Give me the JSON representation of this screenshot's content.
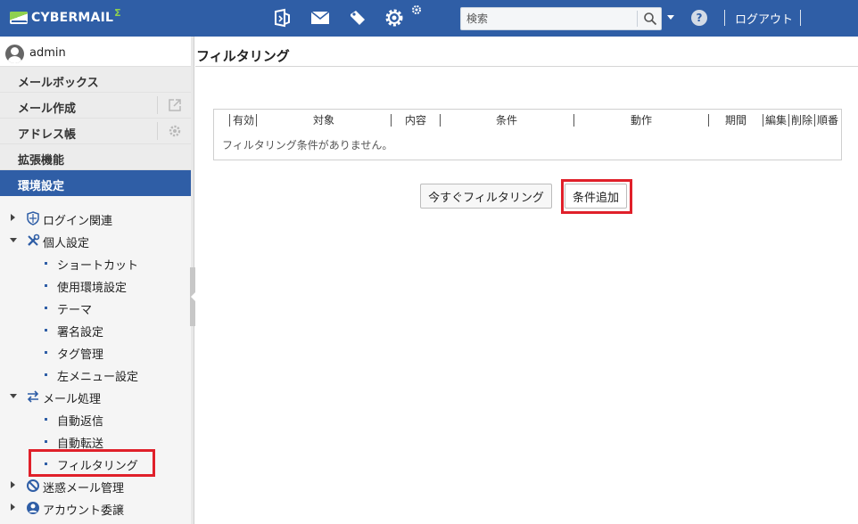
{
  "app": {
    "logo_text": "CYBERMAIL",
    "logo_mark": "Σ"
  },
  "topbar": {
    "icons": [
      "mail-open-icon",
      "envelope-icon",
      "tag-icon",
      "gear-icon",
      "small-gear-icon"
    ],
    "search_placeholder": "検索",
    "logout_label": "ログアウト",
    "help_glyph": "?"
  },
  "user": {
    "name": "admin"
  },
  "nav": {
    "items": [
      {
        "label": "メールボックス"
      },
      {
        "label": "メール作成"
      },
      {
        "label": "アドレス帳"
      },
      {
        "label": "拡張機能"
      },
      {
        "label": "環境設定"
      }
    ],
    "active_index": 4
  },
  "tree": {
    "login": "ログイン関連",
    "personal": "個人設定",
    "personal_children": [
      "ショートカット",
      "使用環境設定",
      "テーマ",
      "署名設定",
      "タグ管理",
      "左メニュー設定"
    ],
    "mail_processing": "メール処理",
    "mail_processing_children": [
      "自動返信",
      "自動転送",
      "フィルタリング"
    ],
    "spam": "迷惑メール管理",
    "account": "アカウント委譲"
  },
  "main": {
    "title": "フィルタリング",
    "columns": [
      "有効",
      "対象",
      "内容",
      "条件",
      "動作",
      "期間",
      "編集",
      "削除",
      "順番"
    ],
    "empty_message": "フィルタリング条件がありません。",
    "filter_now_label": "今すぐフィルタリング",
    "add_condition_label": "条件追加"
  },
  "colors": {
    "brand": "#2f5ea6",
    "highlight": "#e0202a",
    "accent_green": "#8fd14f"
  }
}
